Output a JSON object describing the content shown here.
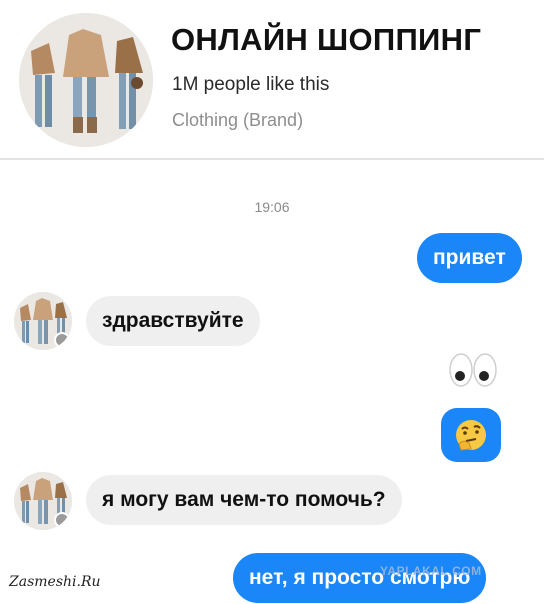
{
  "header": {
    "page_name": "ОНЛАЙН ШОППИНГ",
    "likes": "1M people like this",
    "category": "Clothing (Brand)"
  },
  "conversation": {
    "timestamp": "19:06",
    "messages": [
      {
        "sender": "me",
        "text": "привет"
      },
      {
        "sender": "page",
        "text": "здравствуйте"
      },
      {
        "sender": "me",
        "emoji": "eyes-emoji"
      },
      {
        "sender": "me",
        "emoji": "thinking-face-emoji"
      },
      {
        "sender": "page",
        "text": "я могу вам чем-то помочь?"
      },
      {
        "sender": "me",
        "text": "нет, я просто смотрю"
      }
    ]
  },
  "watermarks": {
    "left": "Zasmeshi.Ru",
    "right": "YAPLAKAL.COM"
  },
  "colors": {
    "outgoing_bubble": "#1a86f7",
    "incoming_bubble": "#efefef",
    "emoji_yellow": "#f7c843"
  }
}
